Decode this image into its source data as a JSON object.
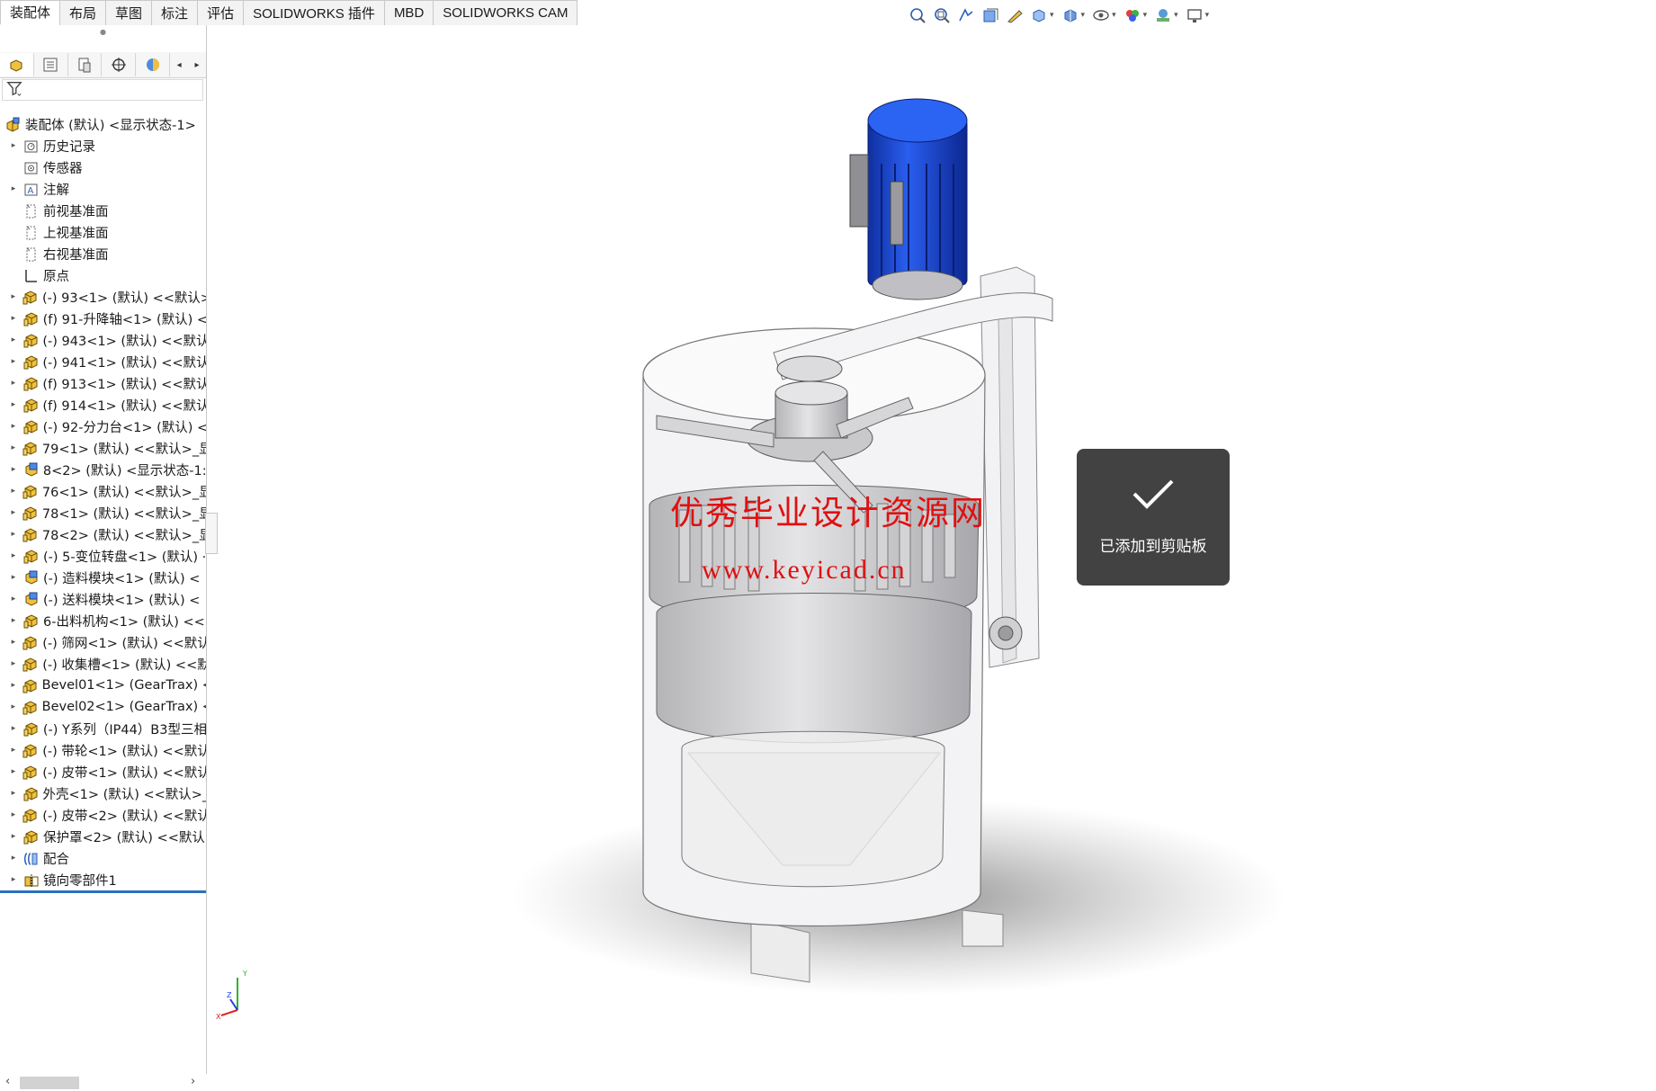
{
  "tabs": [
    {
      "label": "装配体",
      "active": true
    },
    {
      "label": "布局",
      "active": false
    },
    {
      "label": "草图",
      "active": false
    },
    {
      "label": "标注",
      "active": false
    },
    {
      "label": "评估",
      "active": false
    },
    {
      "label": "SOLIDWORKS 插件",
      "active": false
    },
    {
      "label": "MBD",
      "active": false
    },
    {
      "label": "SOLIDWORKS CAM",
      "active": false
    }
  ],
  "view_toolbar_icons": [
    "zoom-to-fit-icon",
    "zoom-to-area-icon",
    "previous-view-icon",
    "section-view-icon",
    "dynamic-annotation-icon",
    "view-orientation-icon",
    "display-style-icon",
    "hide-show-items-icon",
    "edit-appearance-icon",
    "apply-scene-icon",
    "view-settings-icon"
  ],
  "manager_tabs": [
    "featuremanager-tab",
    "propertymanager-tab",
    "configurationmanager-tab",
    "dimxpertmanager-tab",
    "displaymanager-tab"
  ],
  "tree": {
    "root": "装配体 (默认) <显示状态-1>",
    "items": [
      {
        "label": "历史记录",
        "icon": "history-icon",
        "expandable": true
      },
      {
        "label": "传感器",
        "icon": "sensor-icon",
        "expandable": false
      },
      {
        "label": "注解",
        "icon": "annotation-icon",
        "expandable": true
      },
      {
        "label": "前视基准面",
        "icon": "plane-icon",
        "expandable": false
      },
      {
        "label": "上视基准面",
        "icon": "plane-icon",
        "expandable": false
      },
      {
        "label": "右视基准面",
        "icon": "plane-icon",
        "expandable": false
      },
      {
        "label": "原点",
        "icon": "origin-icon",
        "expandable": false
      },
      {
        "label": "(-) 93<1> (默认) <<默认>",
        "icon": "part-icon",
        "expandable": true
      },
      {
        "label": "(f) 91-升降轴<1> (默认) <",
        "icon": "part-icon",
        "expandable": true
      },
      {
        "label": "(-) 943<1> (默认) <<默认",
        "icon": "part-icon",
        "expandable": true
      },
      {
        "label": "(-) 941<1> (默认) <<默认",
        "icon": "part-icon",
        "expandable": true
      },
      {
        "label": "(f) 913<1> (默认) <<默认",
        "icon": "part-icon",
        "expandable": true
      },
      {
        "label": "(f) 914<1> (默认) <<默认",
        "icon": "part-icon",
        "expandable": true
      },
      {
        "label": "(-) 92-分力台<1> (默认) <",
        "icon": "part-icon",
        "expandable": true
      },
      {
        "label": "79<1> (默认) <<默认>_显",
        "icon": "part-icon",
        "expandable": true
      },
      {
        "label": "8<2> (默认) <显示状态-1:",
        "icon": "subassembly-icon",
        "expandable": true
      },
      {
        "label": "76<1> (默认) <<默认>_显",
        "icon": "part-icon",
        "expandable": true
      },
      {
        "label": "78<1> (默认) <<默认>_显",
        "icon": "part-icon",
        "expandable": true
      },
      {
        "label": "78<2> (默认) <<默认>_显",
        "icon": "part-icon",
        "expandable": true
      },
      {
        "label": "(-) 5-变位转盘<1> (默认) ·",
        "icon": "part-icon",
        "expandable": true
      },
      {
        "label": "(-) 造料模块<1> (默认) <",
        "icon": "subassembly-icon",
        "expandable": true
      },
      {
        "label": "(-) 送料模块<1> (默认) <",
        "icon": "subassembly-icon",
        "expandable": true
      },
      {
        "label": "6-出料机构<1> (默认) <<",
        "icon": "part-icon",
        "expandable": true
      },
      {
        "label": "(-) 筛网<1> (默认) <<默认",
        "icon": "part-icon",
        "expandable": true
      },
      {
        "label": "(-) 收集槽<1> (默认) <<默",
        "icon": "part-icon",
        "expandable": true
      },
      {
        "label": "Bevel01<1> (GearTrax) <",
        "icon": "part-icon",
        "expandable": true
      },
      {
        "label": "Bevel02<1> (GearTrax) <",
        "icon": "part-icon",
        "expandable": true
      },
      {
        "label": "(-) Y系列（IP44）B3型三相",
        "icon": "part-icon",
        "expandable": true
      },
      {
        "label": "(-) 带轮<1> (默认) <<默认",
        "icon": "part-icon",
        "expandable": true
      },
      {
        "label": "(-) 皮带<1> (默认) <<默认",
        "icon": "part-icon",
        "expandable": true
      },
      {
        "label": "外壳<1> (默认) <<默认>_",
        "icon": "part-icon",
        "expandable": true
      },
      {
        "label": "(-) 皮带<2> (默认) <<默认",
        "icon": "part-icon",
        "expandable": true
      },
      {
        "label": "保护罩<2> (默认) <<默认",
        "icon": "part-icon",
        "expandable": true
      },
      {
        "label": "配合",
        "icon": "mates-icon",
        "expandable": true
      },
      {
        "label": "镜向零部件1",
        "icon": "mirror-component-icon",
        "expandable": true
      }
    ]
  },
  "watermark": {
    "line1": "优秀毕业设计资源网",
    "line2": "www.keyicad.cn"
  },
  "toast": {
    "message": "已添加到剪贴板"
  },
  "triad": {
    "x": "X",
    "y": "Y",
    "z": "Z"
  },
  "colors": {
    "motor_blue": "#1e4fd6",
    "watermark_red": "#e01010",
    "selection_blue": "#2a6fbd",
    "toast_bg": "#282828"
  }
}
